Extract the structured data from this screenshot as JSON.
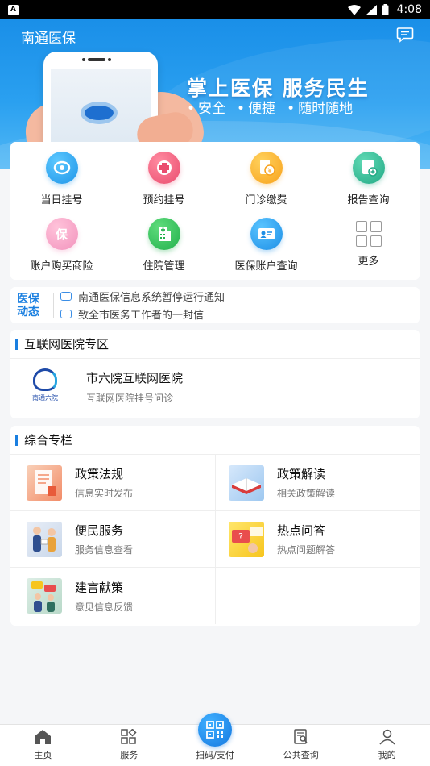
{
  "status_bar": {
    "time": "4:08",
    "app_badge": "A"
  },
  "header": {
    "title": "南通医保"
  },
  "banner": {
    "slogan": "掌上医保  服务民生",
    "tags": [
      "安全",
      "便捷",
      "随时随地"
    ]
  },
  "quick_menu": [
    {
      "label": "当日挂号",
      "icon": "registration-icon"
    },
    {
      "label": "预约挂号",
      "icon": "appointment-icon"
    },
    {
      "label": "门诊缴费",
      "icon": "payment-icon"
    },
    {
      "label": "报告查询",
      "icon": "report-icon"
    },
    {
      "label": "账户购买商险",
      "icon": "insurance-icon",
      "glyph": "保"
    },
    {
      "label": "住院管理",
      "icon": "hospital-icon"
    },
    {
      "label": "医保账户查询",
      "icon": "account-icon"
    },
    {
      "label": "更多",
      "icon": "more-icon"
    }
  ],
  "news": {
    "logo_line1": "医保",
    "logo_line2": "动态",
    "items": [
      "南通医保信息系统暂停运行通知",
      "致全市医务工作者的一封信"
    ]
  },
  "internet_hospital": {
    "section_title": "互联网医院专区",
    "logo_text": "南通六院",
    "name": "市六院互联网医院",
    "desc": "互联网医院挂号问诊"
  },
  "columns": {
    "section_title": "综合专栏",
    "items": [
      {
        "title": "政策法规",
        "sub": "信息实时发布"
      },
      {
        "title": "政策解读",
        "sub": "相关政策解读"
      },
      {
        "title": "便民服务",
        "sub": "服务信息查看"
      },
      {
        "title": "热点问答",
        "sub": "热点问题解答"
      },
      {
        "title": "建言献策",
        "sub": "意见信息反馈"
      }
    ]
  },
  "tabbar": {
    "items": [
      "主页",
      "服务",
      "扫码/支付",
      "公共查询",
      "我的"
    ],
    "active": "主页"
  },
  "colors": {
    "primary": "#1a7fe0",
    "banner": "#2aa0f0"
  }
}
